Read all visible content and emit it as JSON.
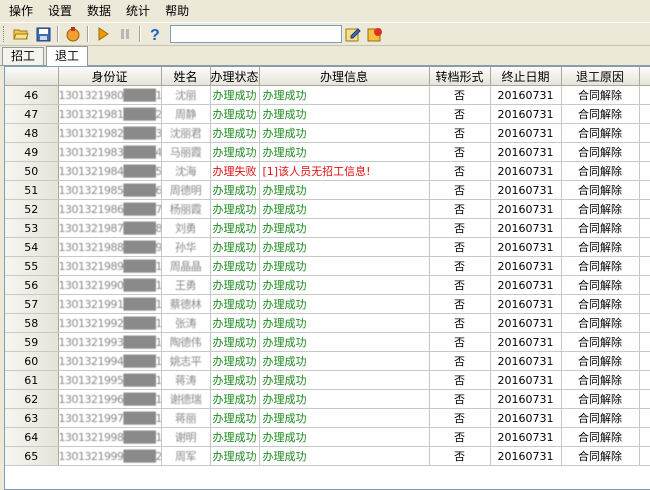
{
  "menu": [
    "操作",
    "设置",
    "数据",
    "统计",
    "帮助"
  ],
  "toolbar": {
    "icons": [
      "open-folder-icon",
      "save-icon",
      "run-icon",
      "play-icon",
      "pause-icon",
      "help-icon"
    ],
    "search_value": "",
    "right_icons": [
      "edit-icon",
      "refresh-icon"
    ]
  },
  "tabs": [
    {
      "label": "招工",
      "active": false
    },
    {
      "label": "退工",
      "active": true
    }
  ],
  "table": {
    "headers": [
      "",
      "身份证",
      "姓名",
      "办理状态",
      "办理信息",
      "转档形式",
      "终止日期",
      "退工原因",
      ""
    ],
    "rows": [
      {
        "num": "46",
        "id": "1301321980████1234",
        "name": "沈丽",
        "status": "办理成功",
        "info": "办理成功",
        "transfer": "否",
        "date": "20160731",
        "reason": "合同解除",
        "ok": true
      },
      {
        "num": "47",
        "id": "1301321981████2233",
        "name": "周静",
        "status": "办理成功",
        "info": "办理成功",
        "transfer": "否",
        "date": "20160731",
        "reason": "合同解除",
        "ok": true
      },
      {
        "num": "48",
        "id": "1301321982████3344",
        "name": "沈丽君",
        "status": "办理成功",
        "info": "办理成功",
        "transfer": "否",
        "date": "20160731",
        "reason": "合同解除",
        "ok": true
      },
      {
        "num": "49",
        "id": "1301321983████4455",
        "name": "马丽霞",
        "status": "办理成功",
        "info": "办理成功",
        "transfer": "否",
        "date": "20160731",
        "reason": "合同解除",
        "ok": true
      },
      {
        "num": "50",
        "id": "1301321984████5566",
        "name": "沈海",
        "status": "办理失败",
        "info": "[1]该人员无招工信息!",
        "transfer": "否",
        "date": "20160731",
        "reason": "合同解除",
        "ok": false
      },
      {
        "num": "51",
        "id": "1301321985████6677",
        "name": "周德明",
        "status": "办理成功",
        "info": "办理成功",
        "transfer": "否",
        "date": "20160731",
        "reason": "合同解除",
        "ok": true
      },
      {
        "num": "52",
        "id": "1301321986████7788",
        "name": "杨丽霞",
        "status": "办理成功",
        "info": "办理成功",
        "transfer": "否",
        "date": "20160731",
        "reason": "合同解除",
        "ok": true
      },
      {
        "num": "53",
        "id": "1301321987████8899",
        "name": "刘勇",
        "status": "办理成功",
        "info": "办理成功",
        "transfer": "否",
        "date": "20160731",
        "reason": "合同解除",
        "ok": true
      },
      {
        "num": "54",
        "id": "1301321988████9900",
        "name": "孙华",
        "status": "办理成功",
        "info": "办理成功",
        "transfer": "否",
        "date": "20160731",
        "reason": "合同解除",
        "ok": true
      },
      {
        "num": "55",
        "id": "1301321989████1011",
        "name": "周晶晶",
        "status": "办理成功",
        "info": "办理成功",
        "transfer": "否",
        "date": "20160731",
        "reason": "合同解除",
        "ok": true
      },
      {
        "num": "56",
        "id": "1301321990████1122",
        "name": "王勇",
        "status": "办理成功",
        "info": "办理成功",
        "transfer": "否",
        "date": "20160731",
        "reason": "合同解除",
        "ok": true
      },
      {
        "num": "57",
        "id": "1301321991████1233",
        "name": "蔡德林",
        "status": "办理成功",
        "info": "办理成功",
        "transfer": "否",
        "date": "20160731",
        "reason": "合同解除",
        "ok": true
      },
      {
        "num": "58",
        "id": "1301321992████1344",
        "name": "张涛",
        "status": "办理成功",
        "info": "办理成功",
        "transfer": "否",
        "date": "20160731",
        "reason": "合同解除",
        "ok": true
      },
      {
        "num": "59",
        "id": "1301321993████1455",
        "name": "陶德伟",
        "status": "办理成功",
        "info": "办理成功",
        "transfer": "否",
        "date": "20160731",
        "reason": "合同解除",
        "ok": true
      },
      {
        "num": "60",
        "id": "1301321994████1566",
        "name": "姚志平",
        "status": "办理成功",
        "info": "办理成功",
        "transfer": "否",
        "date": "20160731",
        "reason": "合同解除",
        "ok": true
      },
      {
        "num": "61",
        "id": "1301321995████1677",
        "name": "蒋涛",
        "status": "办理成功",
        "info": "办理成功",
        "transfer": "否",
        "date": "20160731",
        "reason": "合同解除",
        "ok": true
      },
      {
        "num": "62",
        "id": "1301321996████1788",
        "name": "谢德瑞",
        "status": "办理成功",
        "info": "办理成功",
        "transfer": "否",
        "date": "20160731",
        "reason": "合同解除",
        "ok": true
      },
      {
        "num": "63",
        "id": "1301321997████1899",
        "name": "蒋丽",
        "status": "办理成功",
        "info": "办理成功",
        "transfer": "否",
        "date": "20160731",
        "reason": "合同解除",
        "ok": true
      },
      {
        "num": "64",
        "id": "1301321998████1900",
        "name": "谢明",
        "status": "办理成功",
        "info": "办理成功",
        "transfer": "否",
        "date": "20160731",
        "reason": "合同解除",
        "ok": true
      },
      {
        "num": "65",
        "id": "1301321999████2011",
        "name": "周军",
        "status": "办理成功",
        "info": "办理成功",
        "transfer": "否",
        "date": "20160731",
        "reason": "合同解除",
        "ok": true
      }
    ]
  },
  "colors": {
    "success": "#1b8a1b",
    "failure": "#e01010"
  }
}
